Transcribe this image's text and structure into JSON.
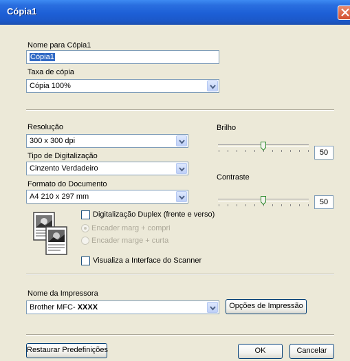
{
  "window": {
    "title": "Cópia1"
  },
  "name_section": {
    "label": "Nome para Cópia1",
    "value": "Cópia1"
  },
  "copy_rate": {
    "label": "Taxa de cópia",
    "selected": "Cópia 100%"
  },
  "scan": {
    "resolution_label": "Resolução",
    "resolution_value": "300 x 300 dpi",
    "scan_type_label": "Tipo de Digitalização",
    "scan_type_value": "Cinzento Verdadeiro",
    "doc_format_label": "Formato do Documento",
    "doc_format_value": "A4 210 x 297 mm",
    "duplex_label": "Digitalização Duplex (frente e verso)",
    "duplex_checked": false,
    "radio_long": "Encader marg + compri",
    "radio_short": "Encader marge + curta",
    "show_interface_label": "Visualiza a Interface do Scanner",
    "show_interface_checked": false
  },
  "brightness": {
    "label": "Brilho",
    "value": "50",
    "level": 50
  },
  "contrast": {
    "label": "Contraste",
    "value": "50",
    "level": 50
  },
  "printer": {
    "label": "Nome da Impressora",
    "name_prefix": "Brother MFC-",
    "name_model": "XXXX",
    "options_button": "Opções de Impressão"
  },
  "footer": {
    "restore_button": "Restaurar Predefinições",
    "ok_button": "OK",
    "cancel_button": "Cancelar"
  },
  "colors": {
    "titlebar": "#1d5fd6",
    "dialog_bg": "#ece9d8",
    "selection": "#316ac5"
  },
  "icons": {
    "close": "close-icon",
    "dropdown": "chevron-down-icon",
    "preview": "duplex-document-icon"
  }
}
